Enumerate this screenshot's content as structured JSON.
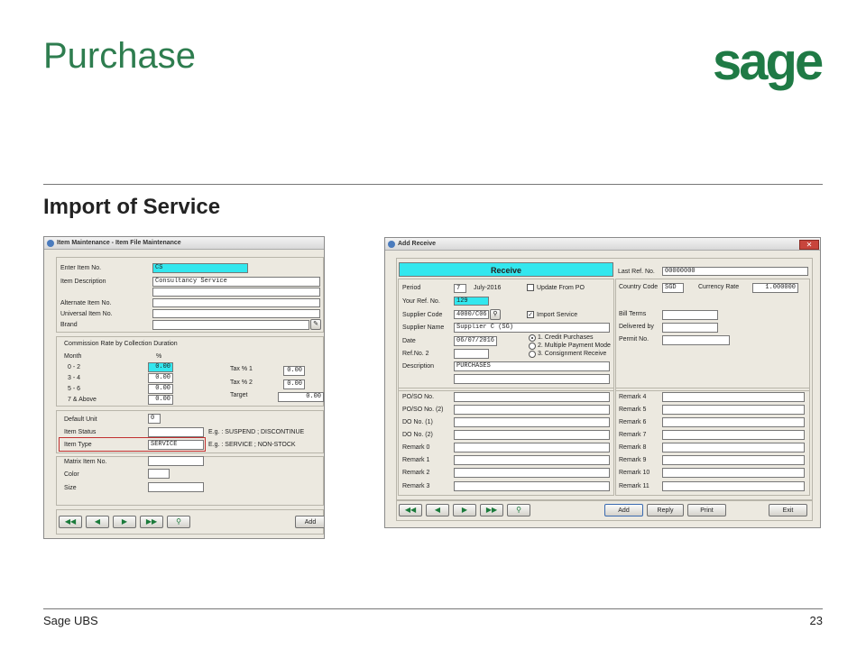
{
  "slide": {
    "title": "Purchase",
    "logo": "sage",
    "subtitle": "Import of Service",
    "footer_left": "Sage UBS",
    "page_number": "23"
  },
  "item_window": {
    "title": "Item Maintenance - Item File Maintenance",
    "enter_item_no_label": "Enter Item No.",
    "enter_item_no": "CS",
    "item_description_label": "Item Description",
    "item_description": "Consultancy Service",
    "item_description_2": "",
    "alternate_item_label": "Alternate Item No.",
    "universal_item_label": "Universal Item No.",
    "brand_label": "Brand",
    "commission_heading": "Commission Rate by Collection Duration",
    "month_label": "Month",
    "pct_label": "%",
    "months": [
      "0 - 2",
      "3 - 4",
      "5 - 6",
      "7 & Above"
    ],
    "rates": [
      "0.00",
      "0.00",
      "0.00",
      "0.00"
    ],
    "tax1_label": "Tax % 1",
    "tax1": "0.00",
    "tax2_label": "Tax % 2",
    "tax2": "0.00",
    "target_label": "Target",
    "target": "0.00",
    "default_unit_label": "Default Unit",
    "default_unit": "0",
    "item_status_label": "Item Status",
    "item_status_hint": "E.g. : SUSPEND ; DISCONTINUE",
    "item_type_label": "Item Type",
    "item_type": "SERVICE",
    "item_type_hint": "E.g. : SERVICE ; NON-STOCK",
    "matrix_label": "Matrix Item No.",
    "color_label": "Color",
    "size_label": "Size",
    "add_button": "Add"
  },
  "receive_window": {
    "title": "Add Receive",
    "banner": "Receive",
    "last_ref_label": "Last Ref. No.",
    "last_ref": "00000000",
    "period_label": "Period",
    "period": "7",
    "period_month": "July-2016",
    "update_from_po": "Update From PO",
    "your_ref_label": "Your Ref. No.",
    "your_ref": "129",
    "supplier_code_label": "Supplier Code",
    "supplier_code": "4000/C06",
    "import_service": "Import Service",
    "supplier_name_label": "Supplier Name",
    "supplier_name": "Supplier C (SG)",
    "date_label": "Date",
    "date": "06/07/2016",
    "options": [
      "1. Credit Purchases",
      "2. Multiple Payment Mode",
      "3. Consignment Receive"
    ],
    "ref2_label": "Ref.No. 2",
    "description_label": "Description",
    "description": "PURCHASES",
    "country_code_label": "Country Code",
    "country_code": "SGD",
    "currency_rate_label": "Currency Rate",
    "currency_rate": "1.000000",
    "bill_terms_label": "Bill Terms",
    "delivered_by_label": "Delivered by",
    "permit_no_label": "Permit No.",
    "left_fields": [
      "PO/SO No.",
      "PO/SO No. (2)",
      "DO No. (1)",
      "DO No. (2)",
      "Remark 0",
      "Remark 1",
      "Remark 2",
      "Remark 3"
    ],
    "right_fields": [
      "Remark 4",
      "Remark 5",
      "Remark 6",
      "Remark 7",
      "Remark 8",
      "Remark 9",
      "Remark 10",
      "Remark 11"
    ],
    "add_button": "Add",
    "reply_button": "Reply",
    "print_button": "Print",
    "exit_button": "Exit"
  },
  "nav_icons": [
    "first-icon",
    "prev-icon",
    "next-icon",
    "last-icon",
    "search-icon"
  ],
  "colors": {
    "brand_green": "#2e7d4f",
    "field_highlight": "#33e7ee",
    "item_type_box": "#c23030"
  }
}
